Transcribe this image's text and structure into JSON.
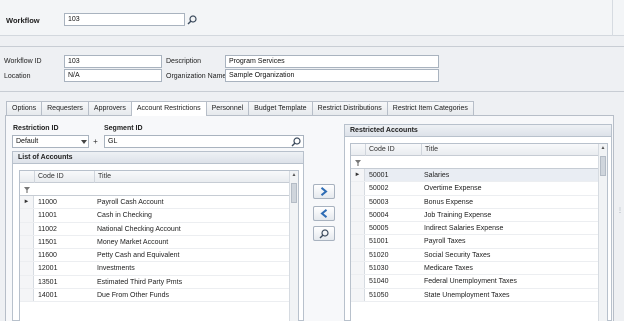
{
  "workflow": {
    "label": "Workflow",
    "value": "103"
  },
  "details": {
    "workflow_id_label": "Workflow ID",
    "workflow_id_value": "103",
    "location_label": "Location",
    "location_value": "N/A",
    "description_label": "Description",
    "description_value": "Program Services",
    "org_name_label": "Organization Name",
    "org_name_value": "Sample Organization"
  },
  "tabs": [
    {
      "label": "Options"
    },
    {
      "label": "Requesters"
    },
    {
      "label": "Approvers"
    },
    {
      "label": "Account Restrictions",
      "active": true
    },
    {
      "label": "Personnel"
    },
    {
      "label": "Budget Template"
    },
    {
      "label": "Restrict Distributions"
    },
    {
      "label": "Restrict Item Categories"
    }
  ],
  "restriction": {
    "restriction_id_label": "Restriction ID",
    "restriction_id_value": "Default",
    "segment_id_label": "Segment ID",
    "segment_id_value": "GL",
    "add_symbol": "+"
  },
  "list_of_accounts": {
    "title": "List of Accounts",
    "col_code": "Code ID",
    "col_title": "Title",
    "rows": [
      {
        "code": "11000",
        "title": "Payroll Cash Account"
      },
      {
        "code": "11001",
        "title": "Cash in Checking"
      },
      {
        "code": "11002",
        "title": "National Checking Account"
      },
      {
        "code": "11501",
        "title": "Money Market Account"
      },
      {
        "code": "11600",
        "title": "Petty Cash and Equivalent"
      },
      {
        "code": "12001",
        "title": "Investments"
      },
      {
        "code": "13501",
        "title": "Estimated Third Party Pmts"
      },
      {
        "code": "14001",
        "title": "Due From Other Funds"
      }
    ]
  },
  "restricted_accounts": {
    "title": "Restricted Accounts",
    "col_code": "Code ID",
    "col_title": "Title",
    "rows": [
      {
        "code": "50001",
        "title": "Salaries"
      },
      {
        "code": "50002",
        "title": "Overtime Expense"
      },
      {
        "code": "50003",
        "title": "Bonus Expense"
      },
      {
        "code": "50004",
        "title": "Job Training Expense"
      },
      {
        "code": "50005",
        "title": "Indirect Salaries Expense"
      },
      {
        "code": "51001",
        "title": "Payroll Taxes"
      },
      {
        "code": "51020",
        "title": "Social Security Taxes"
      },
      {
        "code": "51030",
        "title": "Medicare Taxes"
      },
      {
        "code": "51040",
        "title": "Federal Unemployment Taxes"
      },
      {
        "code": "51050",
        "title": "State Unemployment Taxes"
      }
    ]
  },
  "icons": {
    "search": "search-icon",
    "move_right": "chevron-right-icon",
    "move_left": "chevron-left-icon",
    "filter": "filter-icon"
  },
  "colors": {
    "accent": "#2f6db5",
    "panel": "#f7f8fa"
  }
}
